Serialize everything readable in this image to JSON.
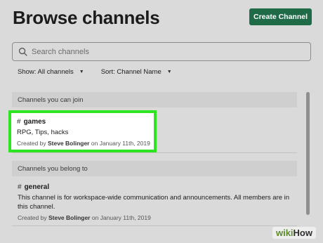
{
  "header": {
    "title": "Browse channels",
    "create_button": "Create Channel"
  },
  "search": {
    "placeholder": "Search channels"
  },
  "filters": {
    "show_label": "Show: All channels",
    "sort_label": "Sort: Channel Name"
  },
  "sections": {
    "join": {
      "header": "Channels you can join",
      "channel": {
        "hash": "#",
        "name": "games",
        "description": "RPG, Tips, hacks",
        "created_prefix": "Created by",
        "creator": "Steve Bolinger",
        "created_suffix": "on January 11th, 2019"
      }
    },
    "member": {
      "header": "Channels you belong to",
      "channel": {
        "hash": "#",
        "name": "general",
        "description": "This channel is for workspace-wide communication and announcements. All members are in this channel.",
        "created_prefix": "Created by",
        "creator": "Steve Bolinger",
        "created_suffix": "on January 11th, 2019"
      }
    }
  },
  "watermark": {
    "part1": "wiki",
    "part2": "How"
  },
  "colors": {
    "accent": "#1f6b47",
    "highlight": "#2ee51f"
  }
}
